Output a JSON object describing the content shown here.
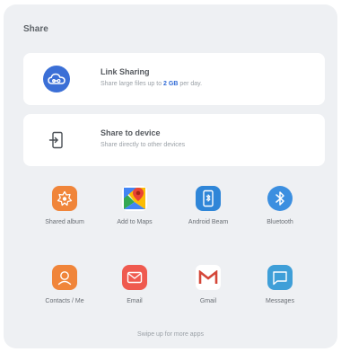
{
  "sheet": {
    "title": "Share"
  },
  "cards": [
    {
      "title": "Link Sharing",
      "subtitle_prefix": "Share large files up to ",
      "subtitle_highlight": "2 GB",
      "subtitle_suffix": " per day.",
      "icon": "cloud-link-icon"
    },
    {
      "title": "Share to device",
      "subtitle": "Share directly to other devices",
      "icon": "share-to-device-icon"
    }
  ],
  "apps": [
    {
      "label": "Shared album",
      "icon": "shared-album-icon",
      "color": "#f0853a"
    },
    {
      "label": "Add to Maps",
      "icon": "maps-icon",
      "color": "#ffffff"
    },
    {
      "label": "Android Beam",
      "icon": "android-beam-icon",
      "color": "#2f86d8"
    },
    {
      "label": "Bluetooth",
      "icon": "bluetooth-icon",
      "color": "#3c8fe0"
    },
    {
      "label": "Contacts / Me",
      "icon": "contacts-icon",
      "color": "#f0853a"
    },
    {
      "label": "Email",
      "icon": "email-icon",
      "color": "#ef5a4f"
    },
    {
      "label": "Gmail",
      "icon": "gmail-icon",
      "color": "#ffffff"
    },
    {
      "label": "Messages",
      "icon": "messages-icon",
      "color": "#3f9fd8"
    }
  ],
  "footer": {
    "text": "Swipe up for more apps"
  }
}
